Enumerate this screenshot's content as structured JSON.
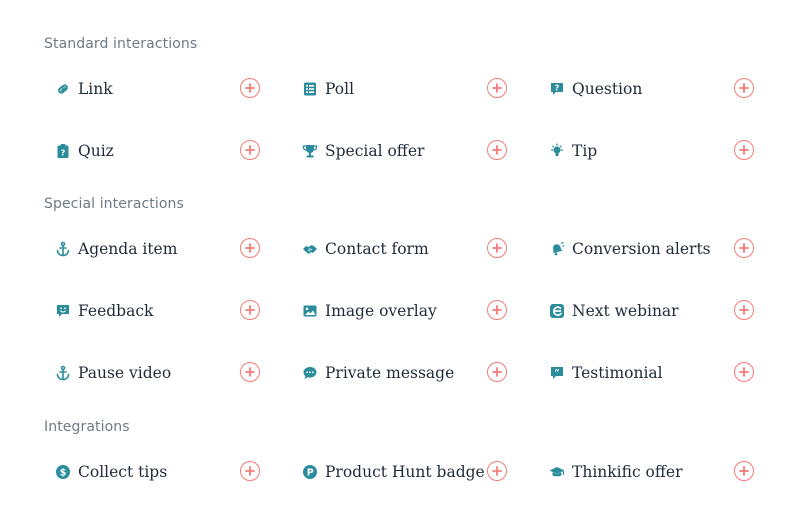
{
  "colors": {
    "icon": "#2b8d9b",
    "add": "#f37b78",
    "label": "#1f2b3a",
    "section": "#6f7a86"
  },
  "sections": [
    {
      "title": "Standard interactions",
      "rows": [
        [
          {
            "label": "Link",
            "icon": "link-icon"
          },
          {
            "label": "Poll",
            "icon": "poll-icon"
          },
          {
            "label": "Question",
            "icon": "question-icon"
          }
        ],
        [
          {
            "label": "Quiz",
            "icon": "quiz-icon"
          },
          {
            "label": "Special offer",
            "icon": "trophy-icon"
          },
          {
            "label": "Tip",
            "icon": "lightbulb-icon"
          }
        ]
      ]
    },
    {
      "title": "Special interactions",
      "rows": [
        [
          {
            "label": "Agenda item",
            "icon": "anchor-icon"
          },
          {
            "label": "Contact form",
            "icon": "handshake-icon"
          },
          {
            "label": "Conversion alerts",
            "icon": "bell-icon"
          }
        ],
        [
          {
            "label": "Feedback",
            "icon": "feedback-icon"
          },
          {
            "label": "Image overlay",
            "icon": "image-icon"
          },
          {
            "label": "Next webinar",
            "icon": "webinar-icon"
          }
        ],
        [
          {
            "label": "Pause video",
            "icon": "anchor-icon"
          },
          {
            "label": "Private message",
            "icon": "chat-icon"
          },
          {
            "label": "Testimonial",
            "icon": "quote-icon"
          }
        ]
      ]
    },
    {
      "title": "Integrations",
      "rows": [
        [
          {
            "label": "Collect tips",
            "icon": "dollar-icon"
          },
          {
            "label": "Product Hunt badge",
            "icon": "product-hunt-icon"
          },
          {
            "label": "Thinkific offer",
            "icon": "graduation-cap-icon"
          }
        ]
      ]
    }
  ]
}
